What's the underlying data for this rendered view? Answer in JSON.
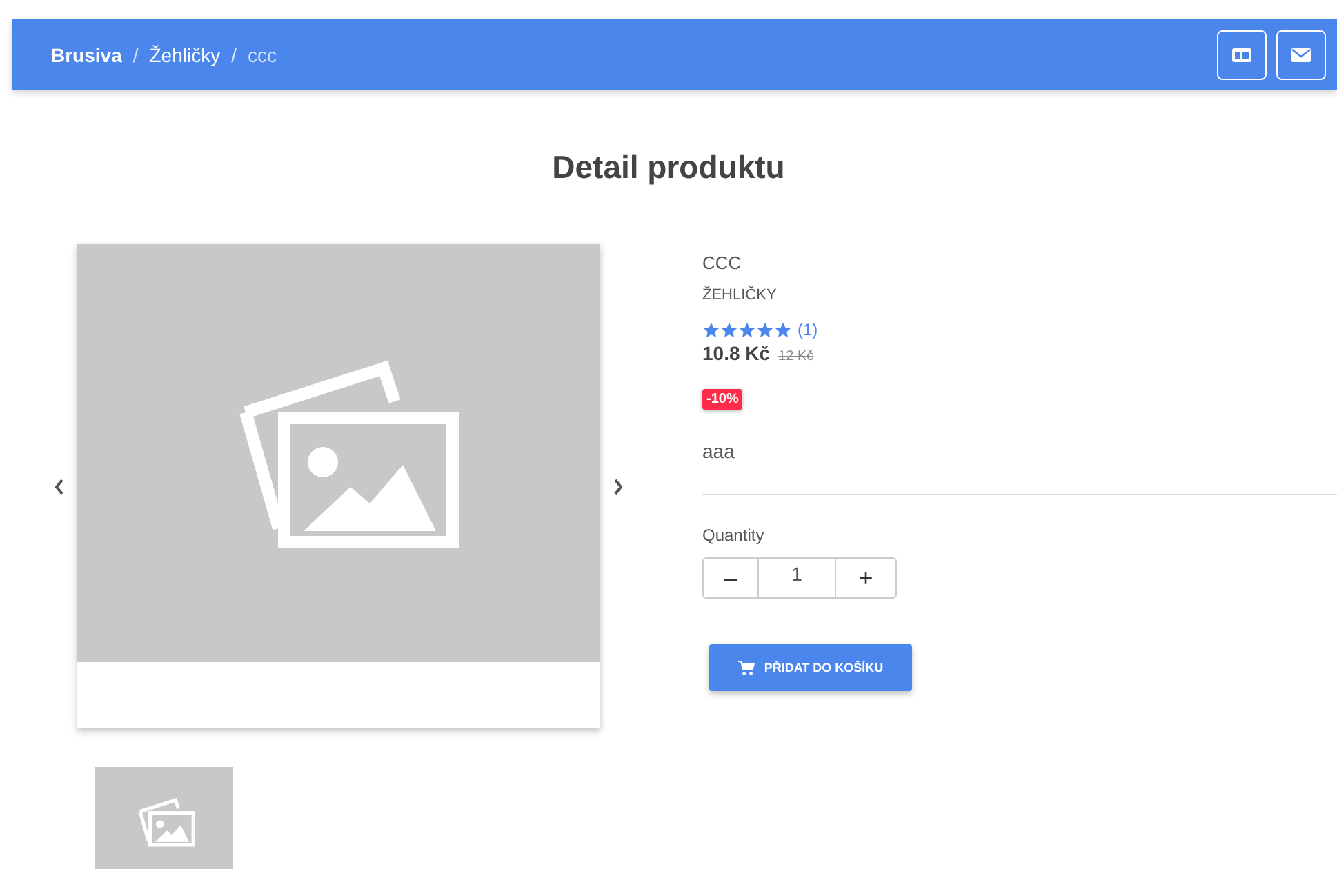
{
  "breadcrumb": [
    {
      "label": "Brusiva",
      "bold": true
    },
    {
      "separator": "/",
      "label": "Žehličky",
      "bold": false
    },
    {
      "separator": "/",
      "label": "ccc",
      "bold": false
    }
  ],
  "page_title": "Detail produktu",
  "product": {
    "name": "CCC",
    "category": "ŽEHLIČKY",
    "stars": 5,
    "review_count": "(1)",
    "price": "10.8 Kč",
    "old_price": "12 Kč",
    "discount": "-10%",
    "description": "aaa"
  },
  "quantity": {
    "label": "Quantity",
    "minus": "–",
    "value": "1",
    "plus": "+"
  },
  "add_to_cart": "PŘIDAT DO KOŠÍKU"
}
